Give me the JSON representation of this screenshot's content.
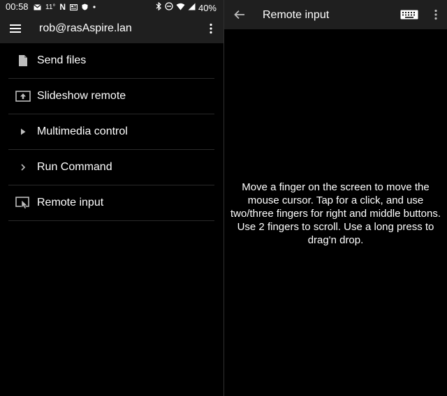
{
  "status_bar": {
    "time": "00:58",
    "temperature": "11°",
    "n_label": "N",
    "battery": "40%",
    "icons": [
      "gmail-icon",
      "netflix-icon",
      "news-icon",
      "shield-icon",
      "dot-icon",
      "bluetooth-icon",
      "do-not-disturb-icon",
      "wifi-icon",
      "signal-icon"
    ]
  },
  "left_pane": {
    "toolbar": {
      "title": "rob@rasAspire.lan",
      "menu_icon": "hamburger-icon",
      "overflow_icon": "more-vert-icon"
    },
    "items": [
      {
        "label": "Send files",
        "icon": "file-icon"
      },
      {
        "label": "Slideshow remote",
        "icon": "presentation-icon"
      },
      {
        "label": "Multimedia control",
        "icon": "play-icon"
      },
      {
        "label": "Run Command",
        "icon": "chevron-right-icon"
      },
      {
        "label": "Remote input",
        "icon": "touchpad-icon"
      }
    ]
  },
  "right_pane": {
    "toolbar": {
      "title": "Remote input",
      "back_icon": "arrow-back-icon",
      "keyboard_icon": "keyboard-icon",
      "overflow_icon": "more-vert-icon"
    },
    "help_text": "Move a finger on the screen to move the mouse cursor. Tap for a click, and use two/three fingers for right and middle buttons. Use 2 fingers to scroll. Use a long press to drag'n drop."
  },
  "colors": {
    "background": "#000000",
    "toolbar": "#1f1f1f",
    "text": "#ffffff",
    "icon": "#bdbdbd",
    "divider": "#2a2a2a"
  }
}
